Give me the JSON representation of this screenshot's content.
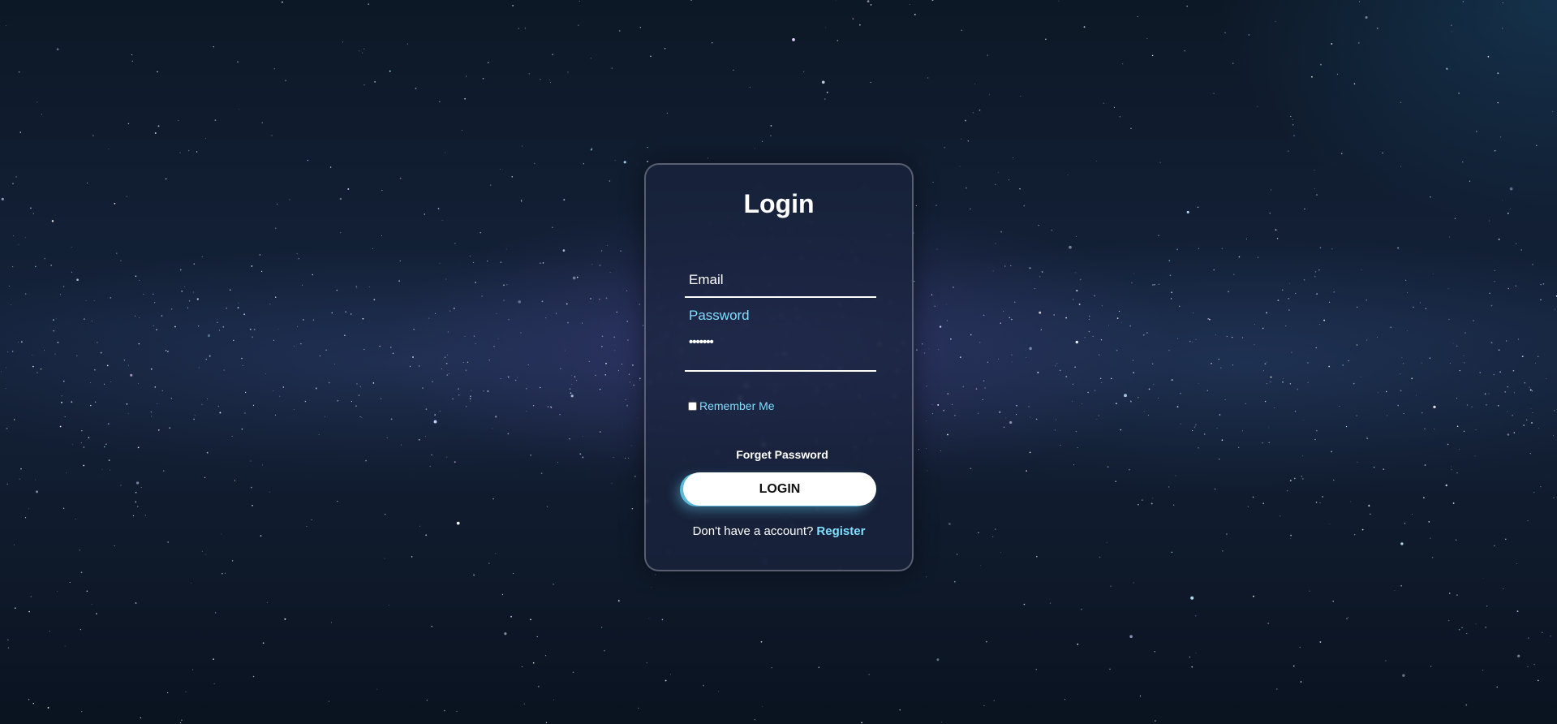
{
  "login_form": {
    "title": "Login",
    "email_label": "Email",
    "password_label": "Password",
    "password_value": "•••••••",
    "remember_label": "Remember Me",
    "remember_checked": false,
    "forget_password": "Forget Password",
    "login_button": "LOGIN",
    "no_account_text": "Don't have a account?",
    "register_link": "Register"
  },
  "colors": {
    "accent": "#7fdfff",
    "card_background": "#1b243e",
    "button_background": "#ffffff"
  }
}
